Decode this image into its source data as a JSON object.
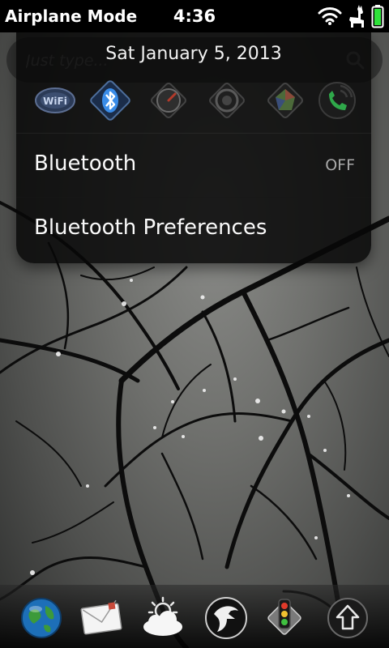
{
  "status_bar": {
    "mode_label": "Airplane Mode",
    "time": "4:36",
    "icons": [
      "wifi-icon",
      "llama-icon",
      "battery-icon"
    ],
    "battery_color": "#2fe23a"
  },
  "search": {
    "placeholder": "Just type..."
  },
  "menu": {
    "date": "Sat January 5, 2013",
    "quick_toggles": [
      {
        "name": "wifi-toggle",
        "label": "WiFi",
        "active": false
      },
      {
        "name": "bluetooth-toggle",
        "active": true,
        "color": "#3a8ce8"
      },
      {
        "name": "performance-toggle",
        "active": false
      },
      {
        "name": "sound-toggle",
        "active": false
      },
      {
        "name": "network-toggle",
        "active": false
      },
      {
        "name": "phone-toggle",
        "active": false,
        "color": "#2fa84a"
      }
    ],
    "items": [
      {
        "label": "Bluetooth",
        "value": "OFF"
      },
      {
        "label": "Bluetooth Preferences"
      }
    ]
  },
  "dock": {
    "icons": [
      "globe-icon",
      "mail-icon",
      "weather-icon",
      "eagle-icon",
      "traffic-light-icon",
      "launcher-icon"
    ]
  }
}
